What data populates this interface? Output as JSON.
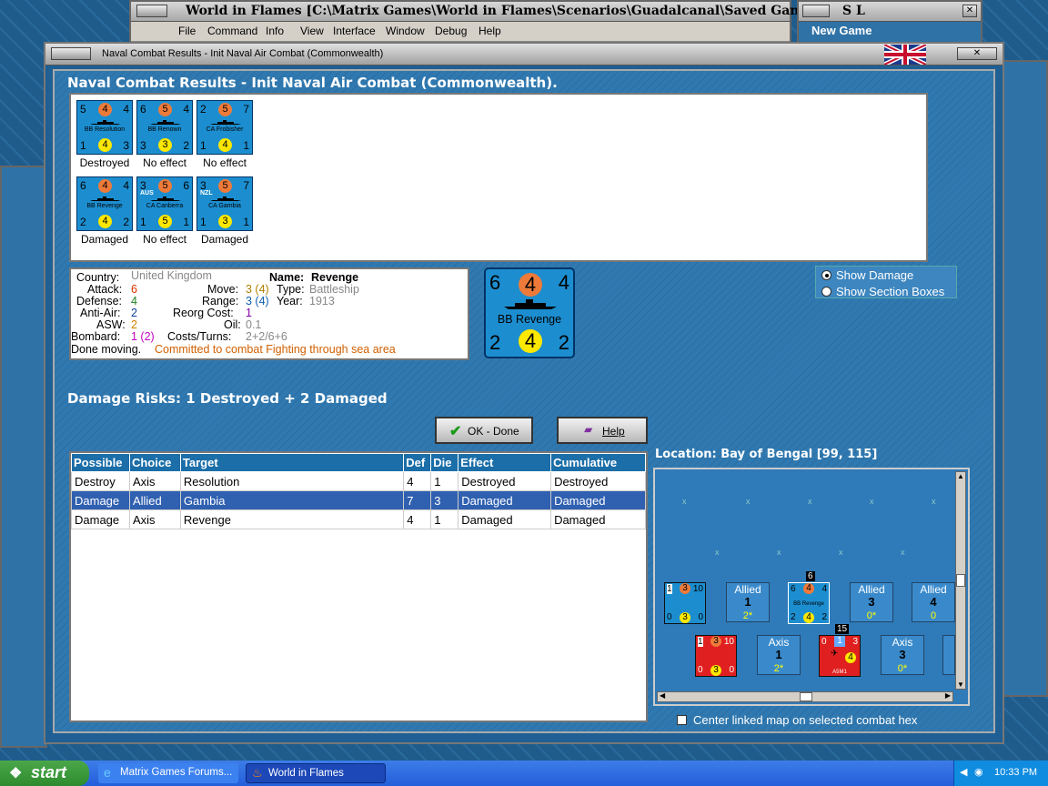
{
  "main_window": {
    "title": "World in Flames [C:\\Matrix Games\\World in Flames\\Scenarios\\Guadalcanal\\Saved Games\\Septemb",
    "menu": [
      "File",
      "Command",
      "Info",
      "View",
      "Interface",
      "Window",
      "Debug",
      "Help"
    ]
  },
  "side_window": {
    "title": "S L",
    "subtitle": "New Game"
  },
  "dialog": {
    "title": "Naval Combat Results - Init Naval Air Combat (Commonwealth)",
    "heading": "Naval Combat Results - Init Naval Air Combat (Commonwealth)."
  },
  "units": [
    {
      "attack": "5",
      "top_circle": "4",
      "move": "4",
      "name": "BB Resolution",
      "bl": "1",
      "bottom_circle": "4",
      "br": "3",
      "result": "Destroyed",
      "nation": ""
    },
    {
      "attack": "6",
      "top_circle": "5",
      "move": "4",
      "name": "BB Renown",
      "bl": "3",
      "bottom_circle": "3",
      "br": "2",
      "result": "No effect",
      "nation": ""
    },
    {
      "attack": "2",
      "top_circle": "5",
      "move": "7",
      "name": "CA Frobisher",
      "bl": "1",
      "bottom_circle": "4",
      "br": "1",
      "result": "No effect",
      "nation": ""
    },
    {
      "attack": "6",
      "top_circle": "4",
      "move": "4",
      "name": "BB Revenge",
      "bl": "2",
      "bottom_circle": "4",
      "br": "2",
      "result": "Damaged",
      "nation": ""
    },
    {
      "attack": "3",
      "top_circle": "5",
      "move": "6",
      "name": "CA Canberra",
      "bl": "1",
      "bottom_circle": "5",
      "br": "1",
      "result": "No effect",
      "nation": "AUS"
    },
    {
      "attack": "3",
      "top_circle": "5",
      "move": "7",
      "name": "CA Gambia",
      "bl": "1",
      "bottom_circle": "3",
      "br": "1",
      "result": "Damaged",
      "nation": "NZL"
    }
  ],
  "info": {
    "country_label": "Country:",
    "country": "United Kingdom",
    "name_label": "Name:",
    "name": "Revenge",
    "attack_label": "Attack:",
    "attack": "6",
    "move_label": "Move:",
    "move": "3 (4)",
    "type_label": "Type:",
    "type": "Battleship",
    "defense_label": "Defense:",
    "defense": "4",
    "range_label": "Range:",
    "range": "3 (4)",
    "year_label": "Year:",
    "year": "1913",
    "aa_label": "Anti-Air:",
    "aa": "2",
    "reorg_label": "Reorg Cost:",
    "reorg": "1",
    "asw_label": "ASW:",
    "asw": "2",
    "oil_label": "Oil:",
    "oil": "0.1",
    "bombard_label": "Bombard:",
    "bombard": "1 (2)",
    "costs_label": "Costs/Turns:",
    "costs": "2+2/6+6",
    "status_label": "Done moving.",
    "status": "Committed to combat Fighting through sea area"
  },
  "big_counter": {
    "tl": "6",
    "top": "4",
    "tr": "4",
    "name": "BB Revenge",
    "bl": "2",
    "bottom": "4",
    "br": "2"
  },
  "options": {
    "show_damage": "Show Damage",
    "show_sections": "Show Section Boxes",
    "selected": "show_damage"
  },
  "damage_risks": "Damage Risks:  1 Destroyed + 2 Damaged",
  "buttons": {
    "ok": "OK - Done",
    "help": "Help"
  },
  "table": {
    "headers": [
      "Possible",
      "Choice",
      "Target",
      "Def",
      "Die",
      "Effect",
      "Cumulative"
    ],
    "rows": [
      [
        "Destroy",
        "Axis",
        "Resolution",
        "4",
        "1",
        "Destroyed",
        "Destroyed"
      ],
      [
        "Damage",
        "Allied",
        "Gambia",
        "7",
        "3",
        "Damaged",
        "Damaged"
      ],
      [
        "Damage",
        "Axis",
        "Revenge",
        "4",
        "1",
        "Damaged",
        "Damaged"
      ]
    ],
    "selected_row": 1
  },
  "location": "Location:  Bay of Bengal [99, 115]",
  "map": {
    "allied_cells": [
      {
        "label": "Allied",
        "num": "1",
        "sub": "2*"
      },
      {
        "label": "Allied",
        "num": "3",
        "sub": "0*"
      },
      {
        "label": "Allied",
        "num": "4",
        "sub": "0"
      }
    ],
    "axis_cells": [
      {
        "label": "Axis",
        "num": "1",
        "sub": "2*"
      },
      {
        "label": "Axis",
        "num": "3",
        "sub": "0*"
      }
    ],
    "stack_counts": [
      "6",
      "15"
    ],
    "ally_counter": {
      "tl": "1",
      "top": "3",
      "tr": "10",
      "bl": "0",
      "bottom": "3",
      "br": "0"
    },
    "rev_counter": {
      "tl": "6",
      "top": "4",
      "tr": "4",
      "name": "BB Revenge",
      "bl": "2",
      "bottom": "4",
      "br": "2"
    },
    "axis_counter": {
      "tl": "1",
      "top": "3",
      "tr": "10",
      "bl": "0",
      "bottom": "3",
      "br": "0"
    },
    "air_counter": {
      "tl": "0",
      "top": "1",
      "tr": "3",
      "name": "A5M1",
      "bottom": "4"
    }
  },
  "center_map_label": "Center linked map on selected combat hex",
  "taskbar": {
    "start": "start",
    "tasks": [
      "Matrix Games Forums...",
      "World in Flames"
    ],
    "clock": "10:33 PM"
  },
  "colors": {
    "dialog_bg": "#1f5f94",
    "counter_blue": "#1c8ed0",
    "axis_red": "#e02020",
    "selected_row": "#3060b0"
  }
}
